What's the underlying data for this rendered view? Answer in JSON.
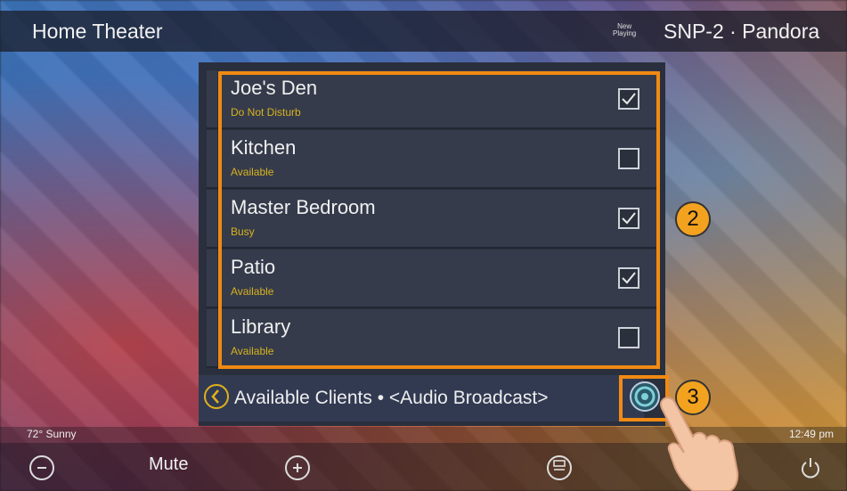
{
  "header": {
    "title": "Home Theater",
    "now_playing": [
      "New",
      "Playing"
    ],
    "source": "SNP-2 · Pandora"
  },
  "clients": [
    {
      "name": "Joe's Den",
      "status": "Do Not Disturb",
      "checked": true
    },
    {
      "name": "Kitchen",
      "status": "Available",
      "checked": false
    },
    {
      "name": "Master Bedroom",
      "status": "Busy",
      "checked": true
    },
    {
      "name": "Patio",
      "status": "Available",
      "checked": true
    },
    {
      "name": "Library",
      "status": "Available",
      "checked": false
    }
  ],
  "footer": {
    "label": "Available Clients • <Audio Broadcast>"
  },
  "status_bar": {
    "weather": "72°  Sunny",
    "time": "12:49 pm"
  },
  "bottom": {
    "mute_label": "Mute"
  },
  "callouts": {
    "list_badge": "2",
    "broadcast_badge": "3"
  },
  "colors": {
    "highlight": "#f08a13",
    "status_text": "#d8b21e",
    "badge": "#f3a21f"
  }
}
